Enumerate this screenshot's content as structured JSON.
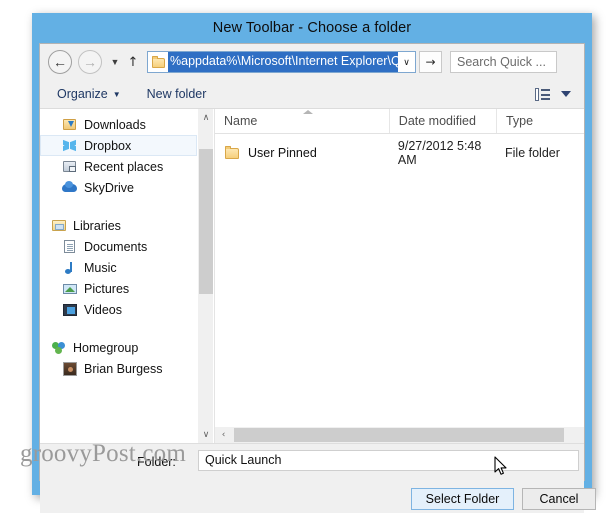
{
  "window": {
    "title": "New Toolbar - Choose a folder",
    "titlebar_color": "#63b0e4"
  },
  "nav": {
    "back_icon": "back-arrow-icon",
    "back_glyph": "←",
    "forward_icon": "forward-arrow-icon",
    "forward_glyph": "→",
    "history_caret": "▼",
    "up_glyph": "↑",
    "address_value": "%appdata%\\Microsoft\\Internet Explorer\\Quick Launch",
    "address_dropdown_glyph": "∨",
    "go_glyph": "→",
    "search_placeholder": "Search Quick ...",
    "selection_color": "#2f6fc4"
  },
  "commandbar": {
    "organize_label": "Organize",
    "organize_caret": "▼",
    "new_folder_label": "New folder",
    "view_icon": "view-layout-icon",
    "help_caret_icon": "chevron-down-icon"
  },
  "sidebar": {
    "items": [
      {
        "label": "Downloads",
        "icon": "downloads-folder-icon",
        "indent": "indent1",
        "selected": false
      },
      {
        "label": "Dropbox",
        "icon": "dropbox-icon",
        "indent": "indent1",
        "selected": true
      },
      {
        "label": "Recent places",
        "icon": "recent-places-icon",
        "indent": "indent1",
        "selected": false
      },
      {
        "label": "SkyDrive",
        "icon": "skydrive-icon",
        "indent": "indent1",
        "selected": false
      },
      {
        "label": "Libraries",
        "icon": "libraries-icon",
        "indent": "root",
        "selected": false,
        "gap_before": true
      },
      {
        "label": "Documents",
        "icon": "documents-icon",
        "indent": "indent1",
        "selected": false
      },
      {
        "label": "Music",
        "icon": "music-icon",
        "indent": "indent1",
        "selected": false
      },
      {
        "label": "Pictures",
        "icon": "pictures-icon",
        "indent": "indent1",
        "selected": false
      },
      {
        "label": "Videos",
        "icon": "videos-icon",
        "indent": "indent1",
        "selected": false
      },
      {
        "label": "Homegroup",
        "icon": "homegroup-icon",
        "indent": "root",
        "selected": false,
        "gap_before": true
      },
      {
        "label": "Brian Burgess",
        "icon": "user-avatar-icon",
        "indent": "indent1",
        "selected": false
      }
    ],
    "scroll_up_glyph": "∧",
    "scroll_down_glyph": "∨"
  },
  "filelist": {
    "columns": [
      {
        "key": "name",
        "label": "Name",
        "sorted": true
      },
      {
        "key": "date",
        "label": "Date modified",
        "sorted": false
      },
      {
        "key": "type",
        "label": "Type",
        "sorted": false
      }
    ],
    "rows": [
      {
        "name": "User Pinned",
        "date": "9/27/2012 5:48 AM",
        "type": "File folder",
        "icon": "folder-icon"
      }
    ],
    "hscroll_left_glyph": "‹"
  },
  "footer": {
    "folder_label": "Folder:",
    "folder_value": "Quick Launch"
  },
  "buttons": {
    "select_label": "Select Folder",
    "cancel_label": "Cancel"
  },
  "watermark": {
    "text": "groovyPost.com"
  }
}
